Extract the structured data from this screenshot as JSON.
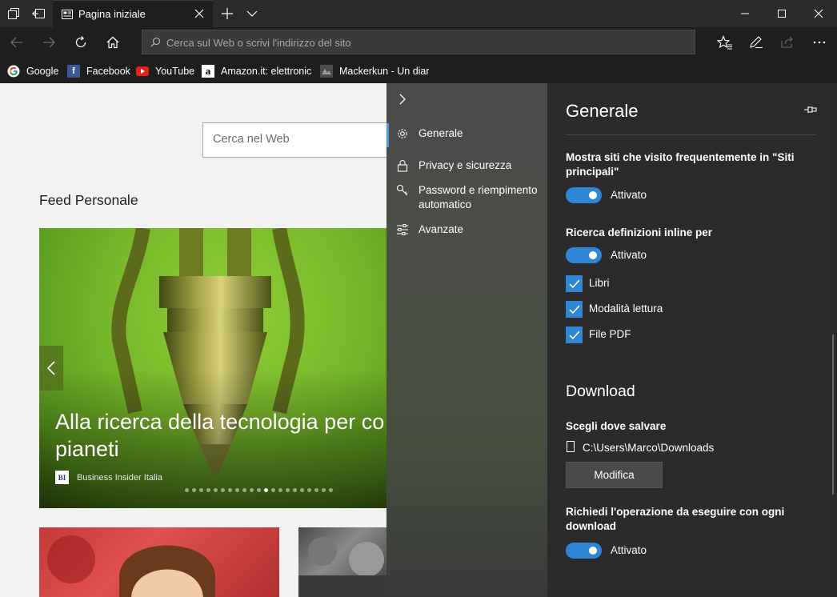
{
  "tabbar": {
    "tab_title": "Pagina iniziale"
  },
  "navbar": {
    "address_placeholder": "Cerca sul Web o scrivi l'indirizzo del sito"
  },
  "favorites": [
    {
      "label": "Google",
      "icon": "google-icon"
    },
    {
      "label": "Facebook",
      "icon": "facebook-icon"
    },
    {
      "label": "YouTube",
      "icon": "youtube-icon"
    },
    {
      "label": "Amazon.it: elettronica",
      "icon": "amazon-icon"
    },
    {
      "label": "Mackerkun - Un diari",
      "icon": "blog-icon"
    }
  ],
  "page": {
    "search_placeholder": "Cerca nel Web",
    "feed_title": "Feed Personale",
    "hero": {
      "title": "Alla ricerca della tecnologia per co\npianeti",
      "source": "Business Insider Italia",
      "source_logo": "BI",
      "dots_total": 21,
      "dot_active_index": 11
    }
  },
  "settings_nav": {
    "items": [
      {
        "label": "Generale",
        "icon": "gear-icon",
        "selected": true
      },
      {
        "label": "Privacy e sicurezza",
        "icon": "lock-icon"
      },
      {
        "label": "Password e riempimento automatico",
        "icon": "key-icon"
      },
      {
        "label": "Avanzate",
        "icon": "sliders-icon"
      }
    ]
  },
  "settings": {
    "title": "Generale",
    "top_sites_label": "Mostra siti che visito frequentemente in \"Siti principali\"",
    "top_sites_state": "Attivato",
    "inline_defs_label": "Ricerca definizioni inline per",
    "inline_defs_state": "Attivato",
    "checks": [
      "Libri",
      "Modalità lettura",
      "File PDF"
    ],
    "download_title": "Download",
    "save_location_label": "Scegli dove salvare",
    "save_path": "C:\\Users\\Marco\\Downloads",
    "modify_button": "Modifica",
    "ask_label": "Richiedi l'operazione da eseguire con ogni download",
    "ask_state": "Attivato"
  },
  "colors": {
    "accent": "#2f86d6",
    "chrome_dark": "#1e1e1e",
    "panel_bg": "#2b2b2b"
  }
}
